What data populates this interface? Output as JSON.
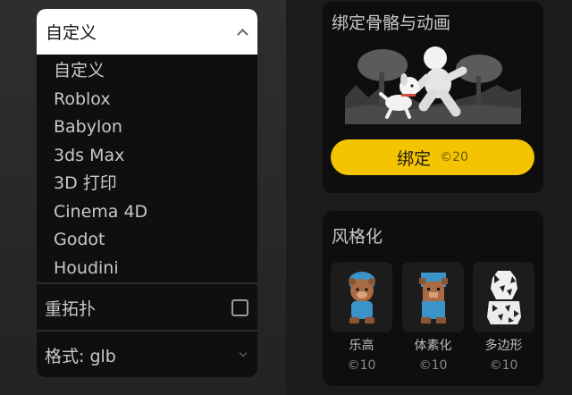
{
  "export": {
    "selected": "自定义",
    "options": [
      "自定义",
      "Roblox",
      "Babylon",
      "3ds Max",
      "3D 打印",
      "Cinema 4D",
      "Godot",
      "Houdini"
    ],
    "retopology_label": "重拓扑",
    "retopology_checked": false,
    "format_label": "格式:",
    "format_value": "glb"
  },
  "rig_card": {
    "title": "绑定骨骼与动画",
    "button_label": "绑定",
    "cost": "©20"
  },
  "style_card": {
    "title": "风格化",
    "styles": [
      {
        "name": "乐高",
        "cost": "©10"
      },
      {
        "name": "体素化",
        "cost": "©10"
      },
      {
        "name": "多边形",
        "cost": "©10"
      }
    ]
  },
  "colors": {
    "accent_yellow": "#f5c400",
    "card_bg": "#0e0e0e",
    "dropdown_header_bg": "#ffffff"
  }
}
